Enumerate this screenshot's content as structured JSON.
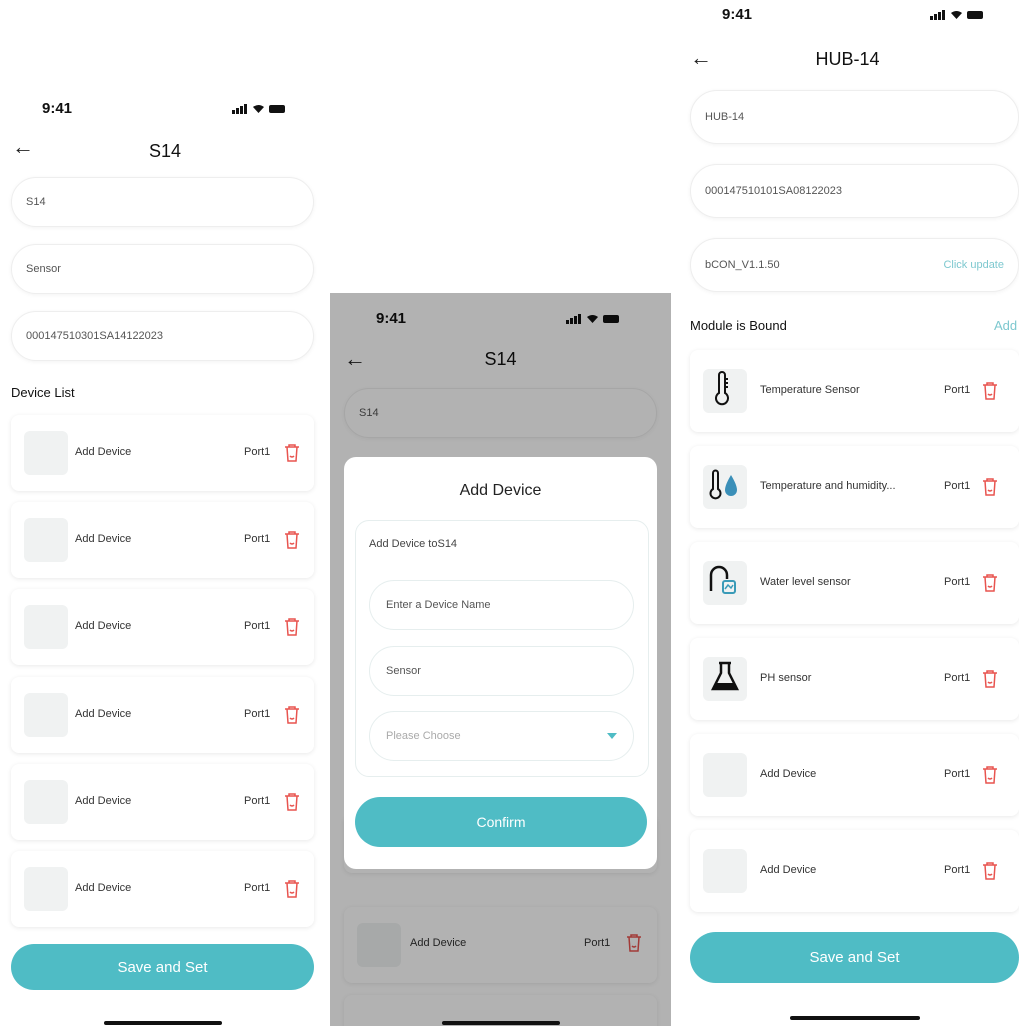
{
  "status_bar": {
    "time": "9:41"
  },
  "left": {
    "title": "S14",
    "fields": [
      "S14",
      "Sensor",
      "000147510301SA14122023"
    ],
    "section_title": "Device List",
    "devices": [
      {
        "label": "Add Device",
        "port": "Port1"
      },
      {
        "label": "Add Device",
        "port": "Port1"
      },
      {
        "label": "Add Device",
        "port": "Port1"
      },
      {
        "label": "Add Device",
        "port": "Port1"
      },
      {
        "label": "Add Device",
        "port": "Port1"
      },
      {
        "label": "Add Device",
        "port": "Port1"
      }
    ],
    "save_button": "Save and Set"
  },
  "middle": {
    "title": "S14",
    "field": "S14",
    "modal": {
      "title": "Add Device",
      "subtitle": "Add Device toS14",
      "name_placeholder": "Enter a Device Name",
      "type_value": "Sensor",
      "choose_placeholder": "Please Choose",
      "confirm_button": "Confirm"
    },
    "background_device": {
      "label": "Add Device",
      "port": "Port1"
    }
  },
  "right": {
    "title": "HUB-14",
    "fields": [
      "HUB-14",
      "000147510101SA08122023",
      "bCON_V1.1.50"
    ],
    "update_link": "Click update",
    "section_title": "Module is Bound",
    "add_link": "Add",
    "modules": [
      {
        "label": "Temperature Sensor",
        "port": "Port1",
        "icon": "thermometer-icon"
      },
      {
        "label": "Temperature and humidity...",
        "port": "Port1",
        "icon": "thermometer-drop-icon"
      },
      {
        "label": "Water level sensor",
        "port": "Port1",
        "icon": "water-level-icon"
      },
      {
        "label": "PH sensor",
        "port": "Port1",
        "icon": "flask-icon"
      },
      {
        "label": "Add Device",
        "port": "Port1",
        "icon": ""
      },
      {
        "label": "Add Device",
        "port": "Port1",
        "icon": ""
      }
    ],
    "save_button": "Save and Set"
  },
  "colors": {
    "accent": "#4fbcc5",
    "delete": "#e8544f",
    "link": "#7dc8cf"
  }
}
